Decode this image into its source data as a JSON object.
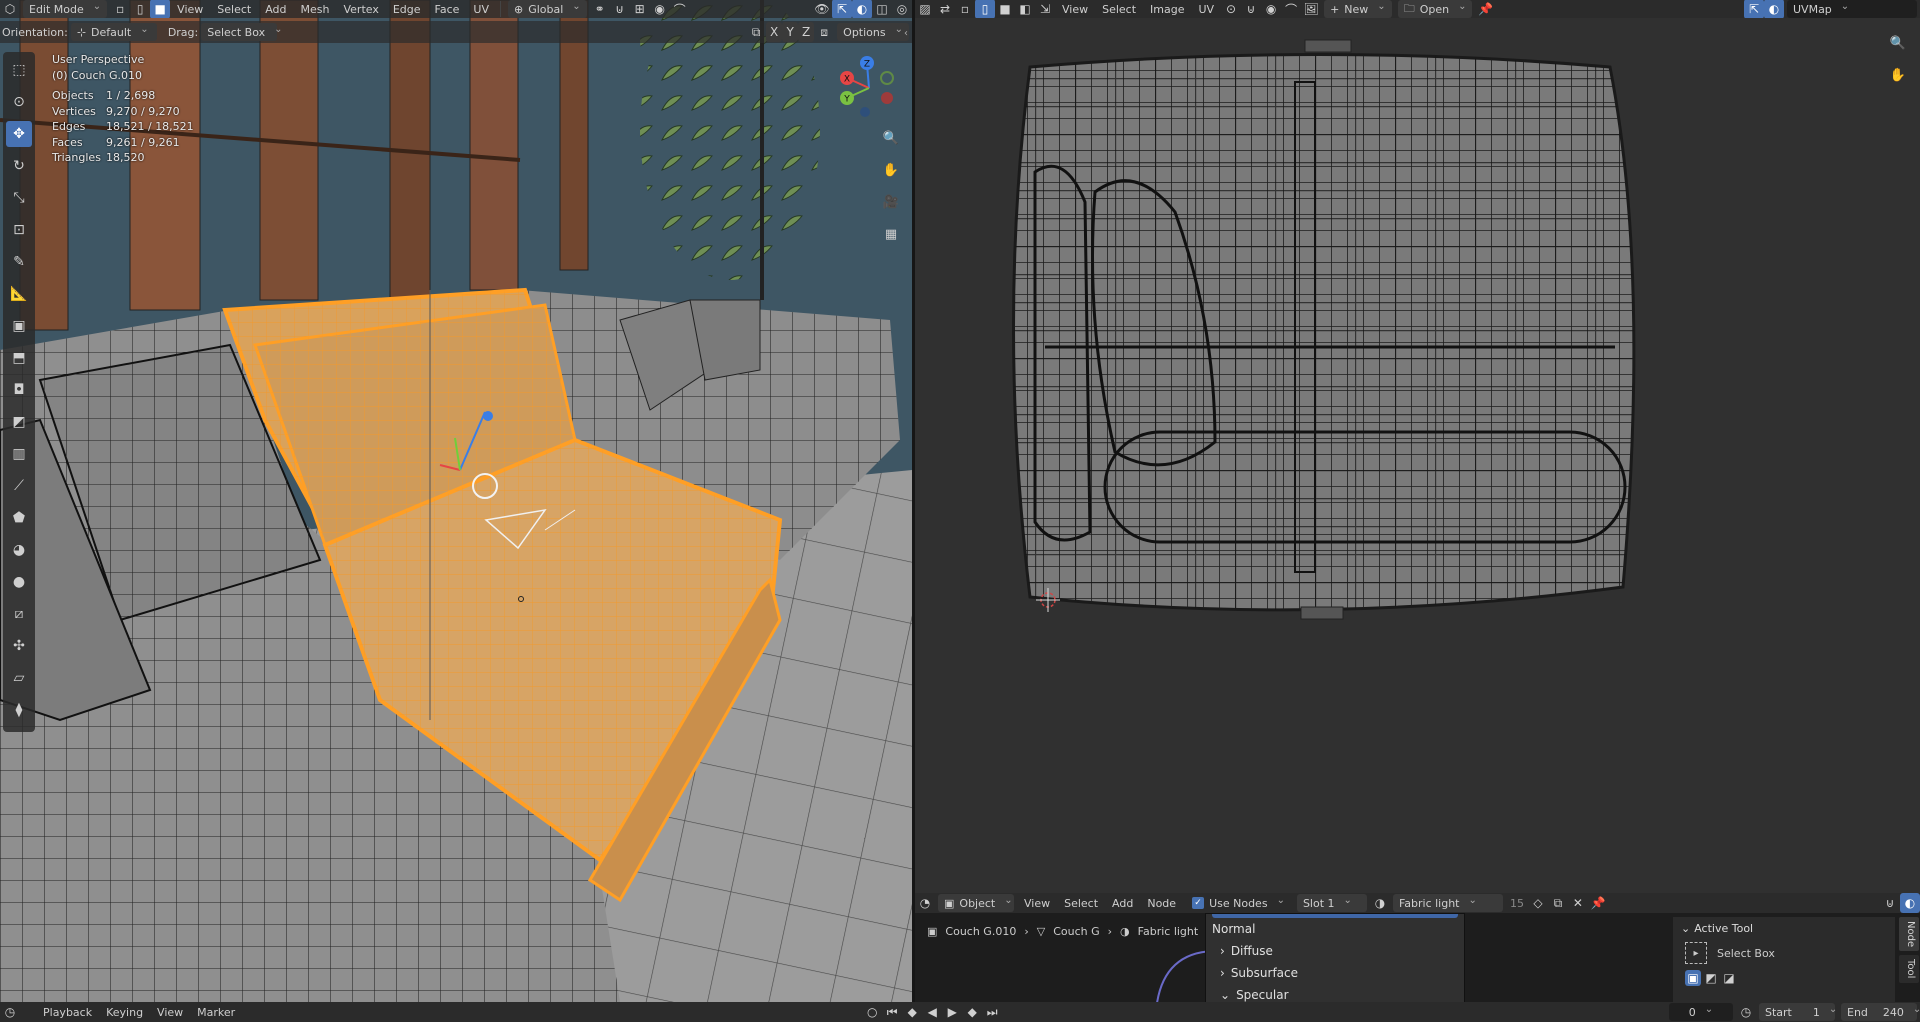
{
  "viewport": {
    "mode": "Edit Mode",
    "menus": [
      "View",
      "Select",
      "Add",
      "Mesh",
      "Vertex",
      "Edge",
      "Face",
      "UV"
    ],
    "transform_space": "Global",
    "orientation_label": "Orientation:",
    "orientation_value": "Default",
    "drag_label": "Drag:",
    "drag_value": "Select Box",
    "options_label": "Options",
    "axis_buttons": [
      "X",
      "Y",
      "Z"
    ],
    "view_name": "User Perspective",
    "object_name": "(0) Couch G.010",
    "stats": [
      {
        "label": "Objects",
        "value": "1 / 2,698"
      },
      {
        "label": "Vertices",
        "value": "9,270 / 9,270"
      },
      {
        "label": "Edges",
        "value": "18,521 / 18,521"
      },
      {
        "label": "Faces",
        "value": "9,261 / 9,261"
      },
      {
        "label": "Triangles",
        "value": "18,520"
      }
    ],
    "gizmo_axes": [
      "X",
      "Y",
      "Z"
    ]
  },
  "uv_editor": {
    "menus": [
      "View",
      "Select",
      "Image",
      "UV"
    ],
    "new_label": "New",
    "open_label": "Open",
    "uvmap_name": "UVMap"
  },
  "node_editor": {
    "object_mode": "Object",
    "menus": [
      "View",
      "Select",
      "Add",
      "Node"
    ],
    "use_nodes_label": "Use Nodes",
    "use_nodes_checked": true,
    "slot": "Slot 1",
    "material_name": "Fabric light",
    "user_count": "15",
    "breadcrumb": [
      "Couch G.010",
      "Couch G",
      "Fabric light"
    ],
    "node_sections": [
      "Normal",
      "Diffuse",
      "Subsurface",
      "Specular"
    ],
    "side_tabs": [
      "Node",
      "Tool"
    ],
    "active_tool_header": "Active Tool",
    "active_tool_name": "Select Box"
  },
  "timeline": {
    "menus": [
      "Playback",
      "Keying",
      "View",
      "Marker"
    ],
    "current_frame": "0",
    "start_label": "Start",
    "start_value": "1",
    "end_label": "End",
    "end_value": "240"
  },
  "colors": {
    "accent": "#4772b3",
    "selection": "#f7a743",
    "header_bg": "#2b2b2b",
    "uv_bg": "#303030"
  }
}
